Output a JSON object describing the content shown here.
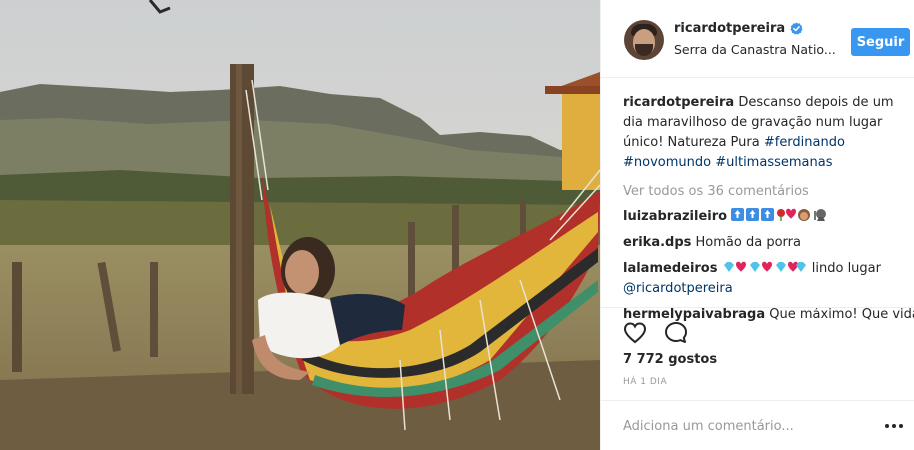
{
  "header": {
    "username": "ricardotpereira",
    "location": "Serra da Canastra Natio...",
    "follow_label": "Seguir",
    "verified_icon": "verified-badge-icon"
  },
  "caption": {
    "username": "ricardotpereira",
    "text": "Descanso depois de um dia maravilhoso de gravação num lugar único! Natureza Pura ",
    "tags": [
      "#ferdinando",
      "#novomundo",
      "#ultimassemanas"
    ]
  },
  "view_all_comments": "Ver todos os 36 comentários",
  "comments": [
    {
      "username": "luizabrazileiro",
      "text": ""
    },
    {
      "username": "erika.dps",
      "text": "Homão da porra"
    },
    {
      "username": "lalamedeiros",
      "text": " lindo lugar",
      "mention": "@ricardotpereira"
    },
    {
      "username": "hermelypaivabraga",
      "text": "Que máximo! Que vida"
    }
  ],
  "actions": {
    "like_icon": "heart-outline-icon",
    "comment_icon": "comment-bubble-icon",
    "likes": "7 772 gostos",
    "time_ago": "HÁ 1 DIA"
  },
  "add_comment": {
    "placeholder": "Adiciona um comentário...",
    "more_icon": "more-options-icon"
  },
  "colors": {
    "accent": "#3897f0",
    "link": "#003569",
    "muted": "#999999"
  }
}
